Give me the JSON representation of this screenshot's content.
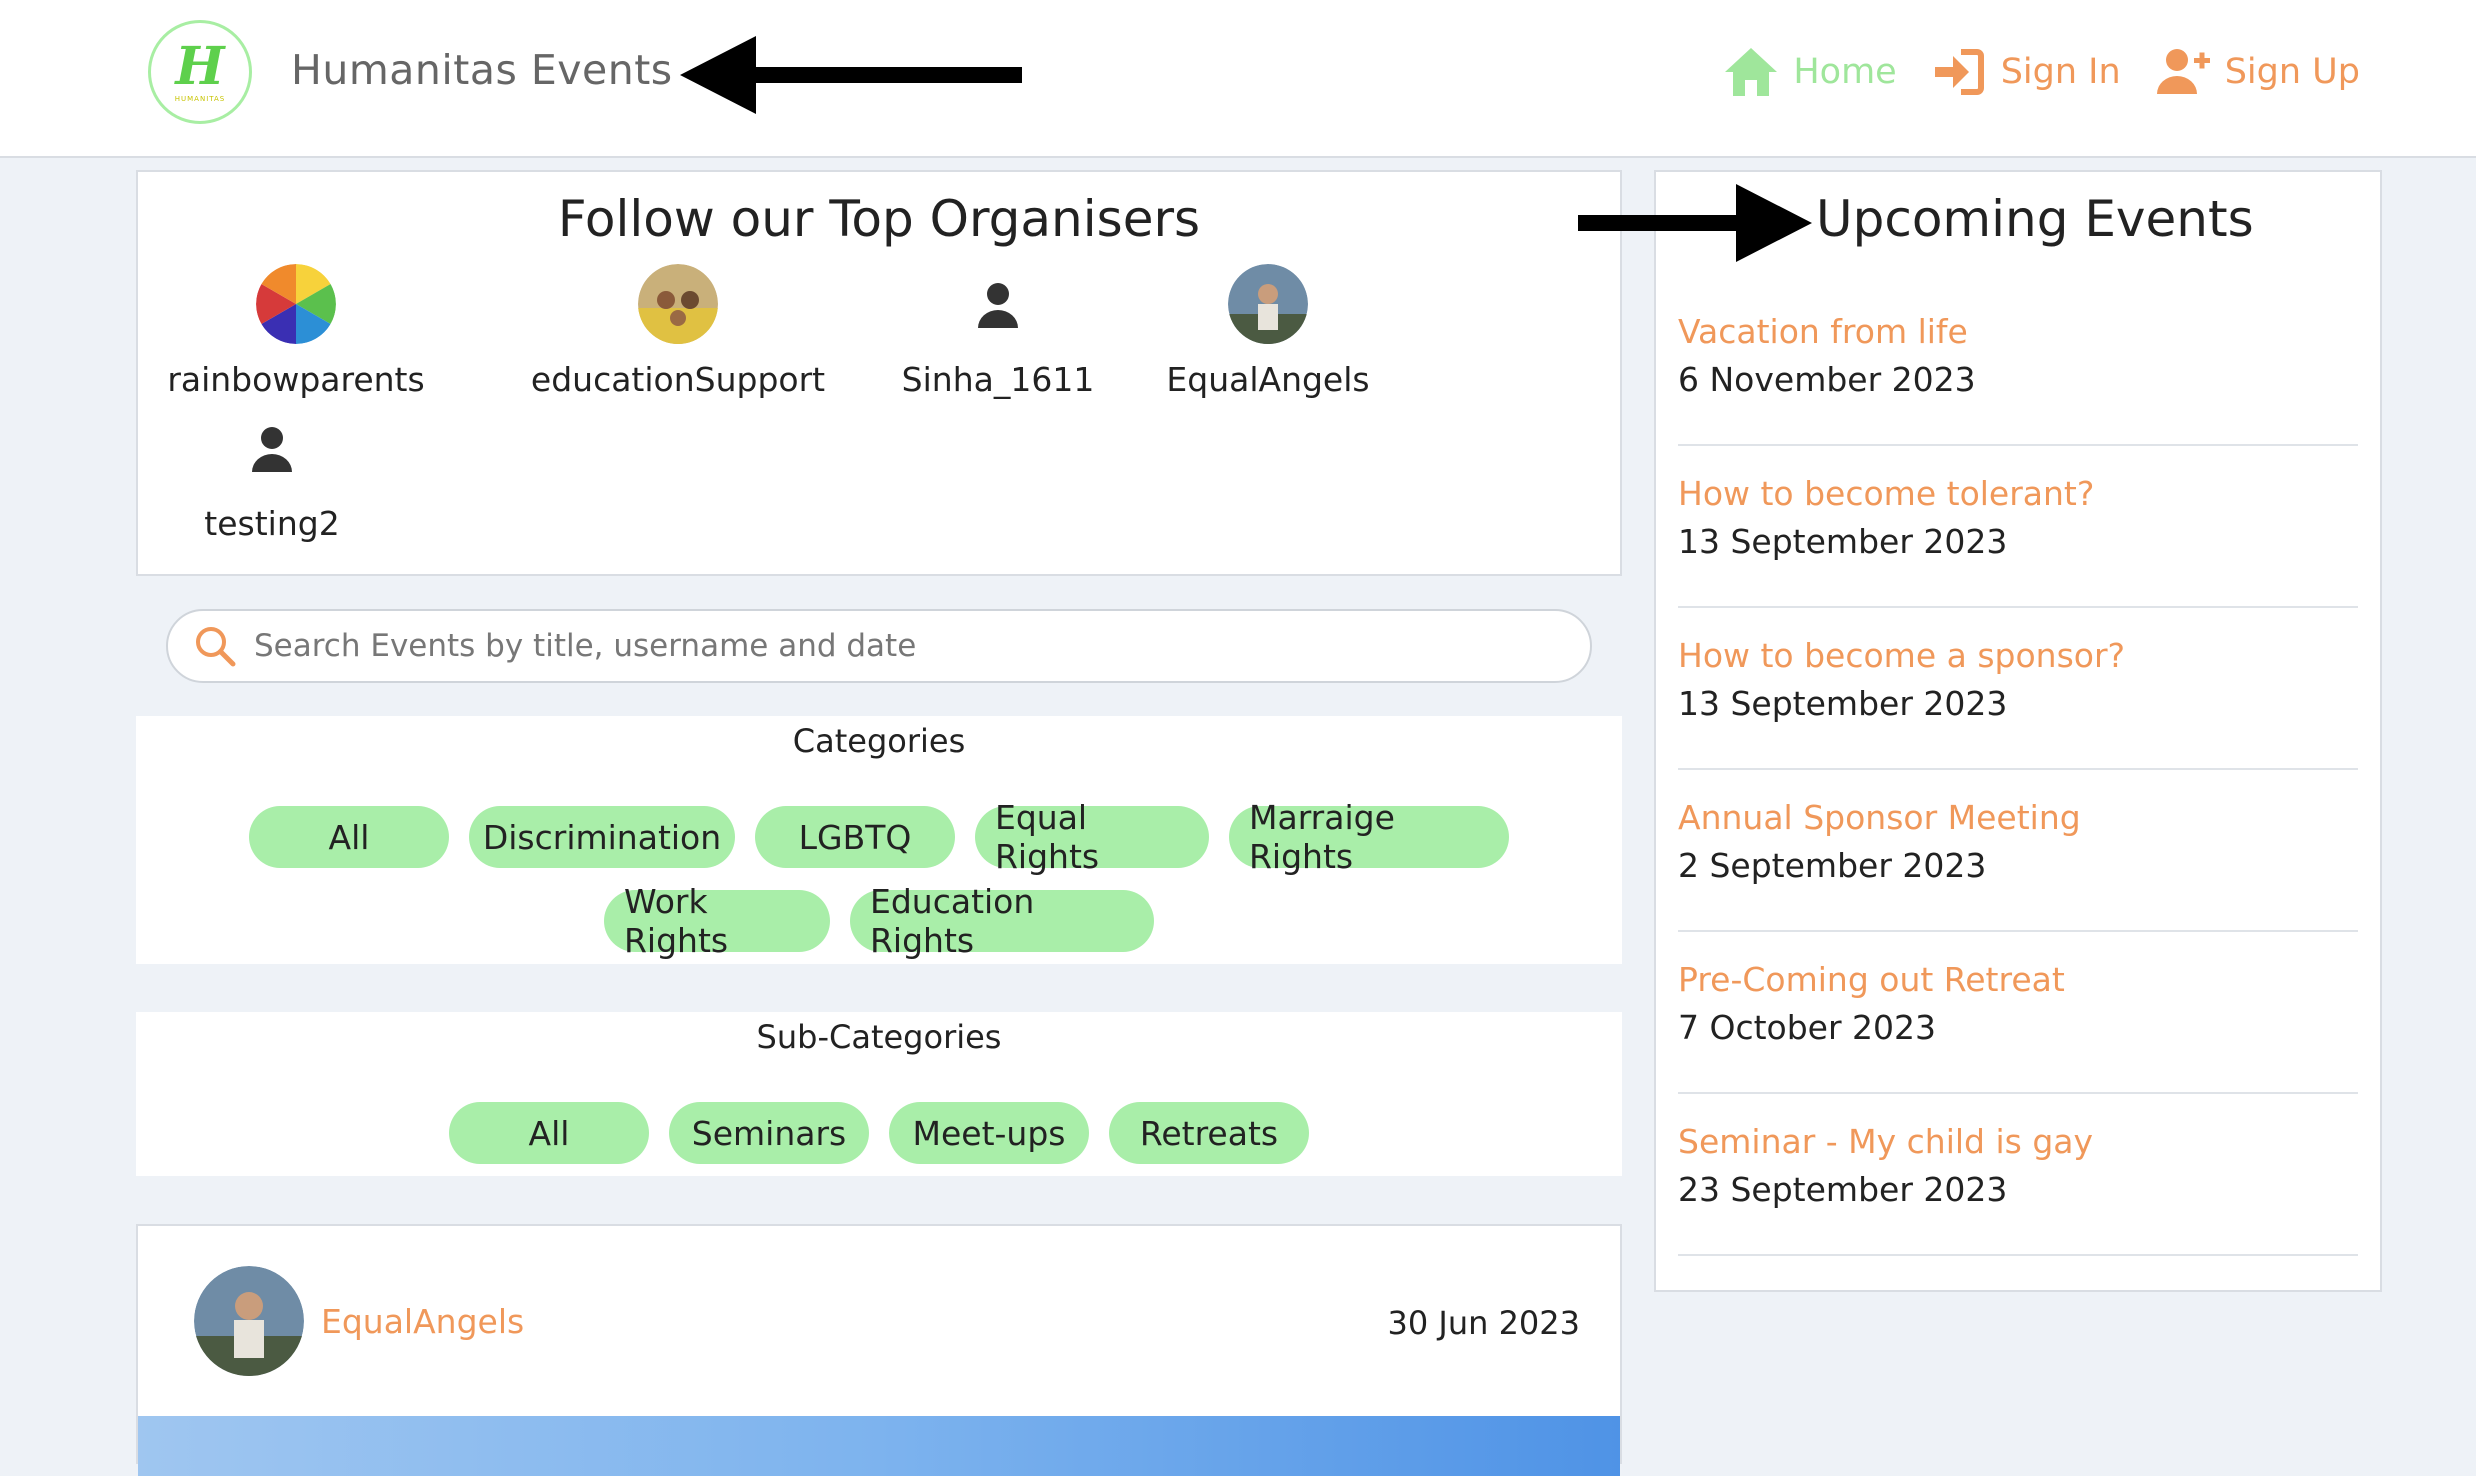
{
  "brand": {
    "name": "Humanitas Events",
    "logo_letter": "H",
    "logo_small": "HUMANITAS"
  },
  "nav": {
    "home": "Home",
    "sign_in": "Sign In",
    "sign_up": "Sign Up"
  },
  "organisers": {
    "title": "Follow our Top Organisers",
    "items": [
      {
        "name": "rainbowparents",
        "avatar": "rainbow-avatar"
      },
      {
        "name": "educationSupport",
        "avatar": "photo-avatar"
      },
      {
        "name": "Sinha_1611",
        "avatar": "person-icon"
      },
      {
        "name": "EqualAngels",
        "avatar": "photo-avatar"
      },
      {
        "name": "testing2",
        "avatar": "person-icon"
      }
    ]
  },
  "search": {
    "placeholder": "Search Events by title, username and date",
    "value": ""
  },
  "categories": {
    "label": "Categories",
    "items": [
      "All",
      "Discrimination",
      "LGBTQ",
      "Equal Rights",
      "Marraige Rights",
      "Work Rights",
      "Education Rights"
    ]
  },
  "subcategories": {
    "label": "Sub-Categories",
    "items": [
      "All",
      "Seminars",
      "Meet-ups",
      "Retreats"
    ]
  },
  "post": {
    "username": "EqualAngels",
    "date": "30 Jun 2023"
  },
  "upcoming": {
    "title": "Upcoming Events",
    "events": [
      {
        "title": "Vacation from life",
        "date": "6 November 2023"
      },
      {
        "title": "How to become tolerant?",
        "date": "13 September 2023"
      },
      {
        "title": "How to become a sponsor?",
        "date": "13 September 2023"
      },
      {
        "title": "Annual Sponsor Meeting",
        "date": "2 September 2023"
      },
      {
        "title": "Pre-Coming out Retreat",
        "date": "7 October 2023"
      },
      {
        "title": "Seminar - My child is gay",
        "date": "23 September 2023"
      }
    ]
  },
  "colors": {
    "accent": "#f0985a",
    "pill": "#a9eea9",
    "home": "#9fe69b",
    "background": "#eef2f7"
  }
}
